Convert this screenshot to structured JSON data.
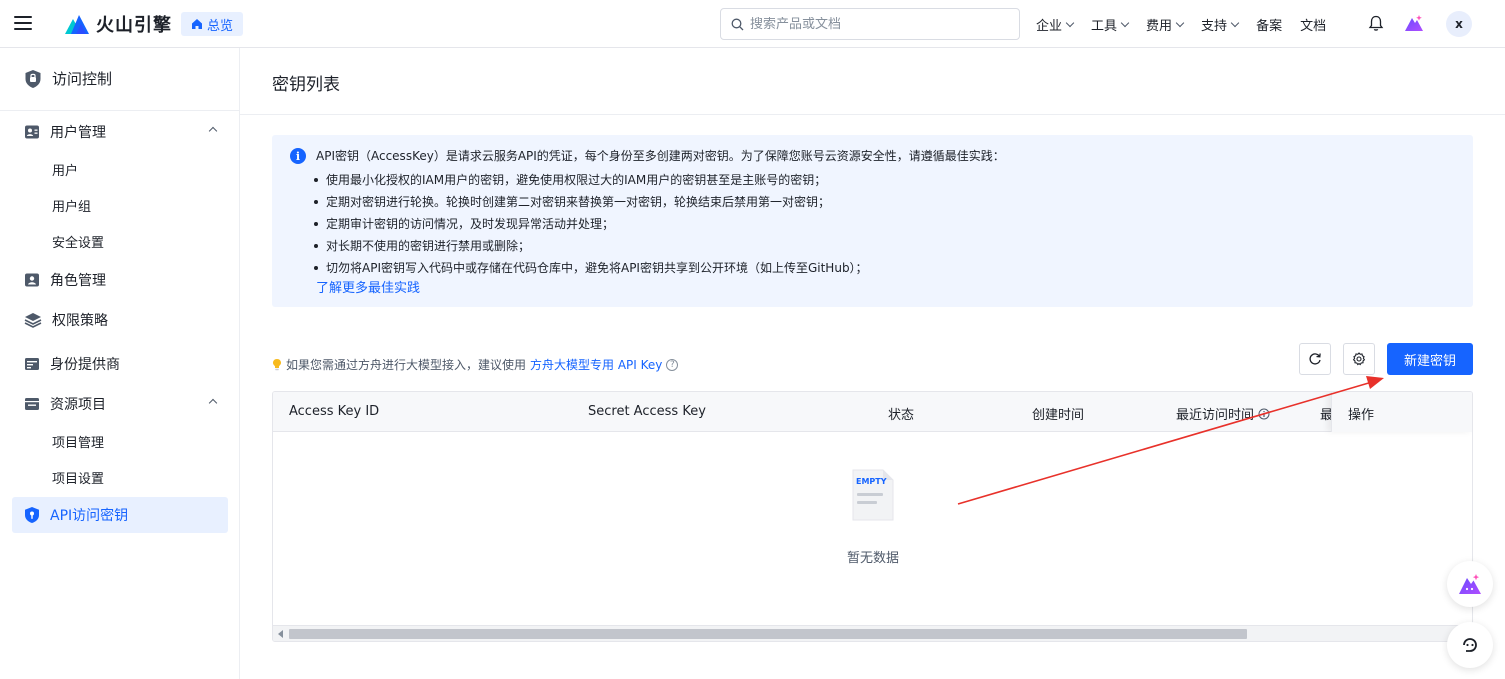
{
  "header": {
    "brand": "火山引擎",
    "home_label": "总览",
    "search_placeholder": "搜索产品或文档",
    "nav": [
      {
        "label": "企业",
        "has_dropdown": true
      },
      {
        "label": "工具",
        "has_dropdown": true
      },
      {
        "label": "费用",
        "has_dropdown": true
      },
      {
        "label": "支持",
        "has_dropdown": true
      },
      {
        "label": "备案",
        "has_dropdown": false
      },
      {
        "label": "文档",
        "has_dropdown": false
      }
    ],
    "avatar_letter": "x",
    "icons": [
      "menu-icon",
      "volcano-logo-icon",
      "home-icon",
      "search-icon",
      "bell-icon",
      "ai-assistant-icon"
    ]
  },
  "sidebar": {
    "title": "访问控制",
    "groups": [
      {
        "label": "用户管理",
        "expanded": true,
        "icon": "user-card-icon",
        "children": [
          "用户",
          "用户组",
          "安全设置"
        ]
      },
      {
        "label": "角色管理",
        "icon": "role-icon"
      },
      {
        "label": "权限策略",
        "icon": "layers-icon"
      },
      {
        "label": "身份提供商",
        "icon": "id-provider-icon"
      },
      {
        "label": "资源项目",
        "expanded": true,
        "icon": "folder-icon",
        "children": [
          "项目管理",
          "项目设置"
        ]
      }
    ],
    "active_item": "API访问密钥"
  },
  "main": {
    "title": "密钥列表",
    "alert": {
      "head": "API密钥（AccessKey）是请求云服务API的凭证，每个身份至多创建两对密钥。为了保障您账号云资源安全性，请遵循最佳实践：",
      "items": [
        "使用最小化授权的IAM用户的密钥，避免使用权限过大的IAM用户的密钥甚至是主账号的密钥；",
        "定期对密钥进行轮换。轮换时创建第二对密钥来替换第一对密钥，轮换结束后禁用第一对密钥；",
        "定期审计密钥的访问情况，及时发现异常活动并处理；",
        "对长期不使用的密钥进行禁用或删除；",
        "切勿将API密钥写入代码中或存储在代码仓库中，避免将API密钥共享到公开环境（如上传至GitHub）；"
      ],
      "link": "了解更多最佳实践"
    },
    "hint": {
      "text": "如果您需通过方舟进行大模型接入，建议使用",
      "link": "方舟大模型专用 API Key",
      "help": "?"
    },
    "create_button": "新建密钥",
    "table": {
      "columns": [
        "Access Key ID",
        "Secret Access Key",
        "状态",
        "创建时间",
        "最近访问时间",
        "最",
        "操作"
      ],
      "rows": [],
      "empty_tag": "EMPTY",
      "empty_text": "暂无数据"
    }
  },
  "colors": {
    "primary": "#1664ff",
    "alert_bg": "#f0f5ff",
    "annotation_arrow": "#e8312a"
  }
}
